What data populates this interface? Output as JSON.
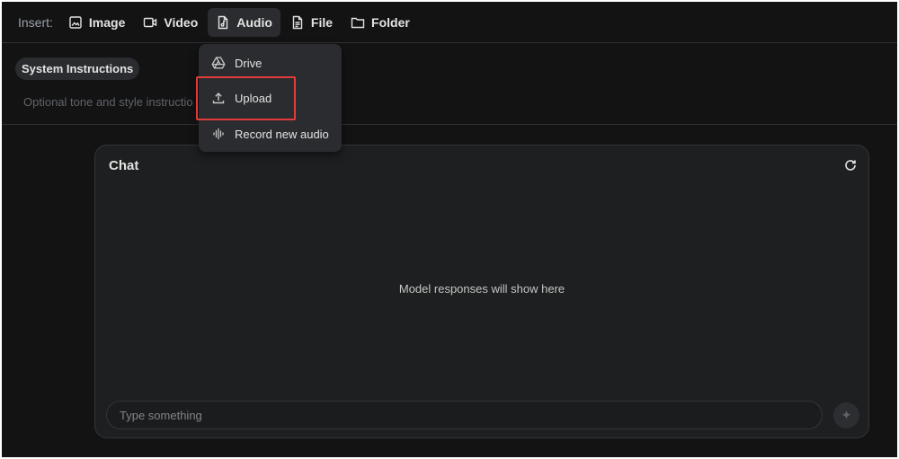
{
  "toolbar": {
    "insert_label": "Insert:",
    "buttons": [
      {
        "label": "Image",
        "icon": "image-icon"
      },
      {
        "label": "Video",
        "icon": "video-icon"
      },
      {
        "label": "Audio",
        "icon": "audio-file-icon",
        "active": true
      },
      {
        "label": "File",
        "icon": "file-icon"
      },
      {
        "label": "Folder",
        "icon": "folder-icon"
      }
    ]
  },
  "audio_menu": {
    "items": [
      {
        "label": "Drive",
        "icon": "drive-icon"
      },
      {
        "label": "Upload",
        "icon": "upload-icon",
        "highlighted": true
      },
      {
        "label": "Record new audio",
        "icon": "waveform-icon"
      }
    ]
  },
  "system_instructions": {
    "chip_label": "System Instructions",
    "placeholder": "Optional tone and style instructio"
  },
  "chat": {
    "title": "Chat",
    "empty_message": "Model responses will show here",
    "input_placeholder": "Type something"
  },
  "colors": {
    "background": "#131314",
    "panel": "#1e1f20",
    "menu": "#2b2c2f",
    "text": "#e3e3e3",
    "highlight": "#e23b3b"
  }
}
